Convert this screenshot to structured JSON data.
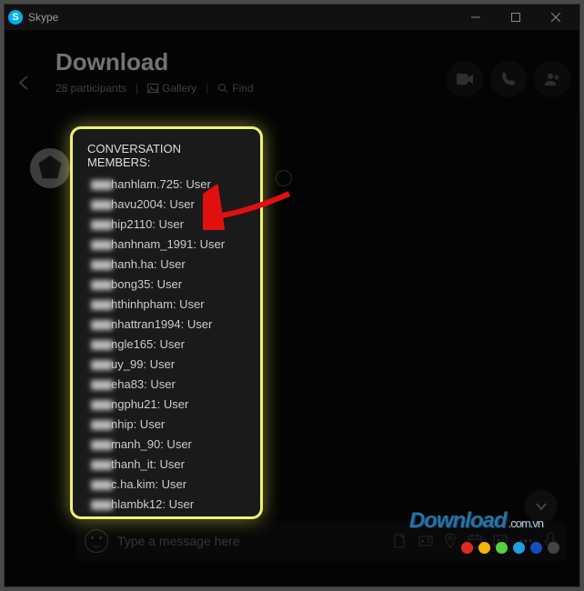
{
  "app": {
    "title": "Skype"
  },
  "window_controls": {
    "min": "minimize",
    "max": "maximize",
    "close": "close"
  },
  "header": {
    "title": "Download",
    "participants": "28 participants",
    "gallery": "Gallery",
    "find": "Find"
  },
  "popup": {
    "title": "CONVERSATION MEMBERS:",
    "members": [
      {
        "suffix": "hanhlam.725: User"
      },
      {
        "suffix": "havu2004: User"
      },
      {
        "suffix": "hip2110: User"
      },
      {
        "suffix": "hanhnam_1991: User"
      },
      {
        "suffix": "hanh.ha: User"
      },
      {
        "suffix": "bong35: User"
      },
      {
        "suffix": "hthinhpham: User"
      },
      {
        "suffix": "nhattran1994: User"
      },
      {
        "suffix": "ngle165: User"
      },
      {
        "suffix": "uy_99: User"
      },
      {
        "suffix": "eha83: User"
      },
      {
        "suffix": "ngphu21: User"
      },
      {
        "suffix": "nhip: User"
      },
      {
        "suffix": "manh_90: User"
      },
      {
        "suffix": "thanh_it: User"
      },
      {
        "suffix": "c.ha.kim: User"
      },
      {
        "suffix": "hlambk12: User"
      }
    ]
  },
  "input": {
    "placeholder": "Type a message here"
  },
  "watermark": {
    "text": "Download",
    "ext": ".com.vn"
  },
  "colors": {
    "highlight_border": "#f0f070",
    "arrow": "#e01010",
    "dots": [
      "#e02828",
      "#f7b500",
      "#55d040",
      "#1ea0e0",
      "#1050c0",
      "#444444"
    ]
  }
}
